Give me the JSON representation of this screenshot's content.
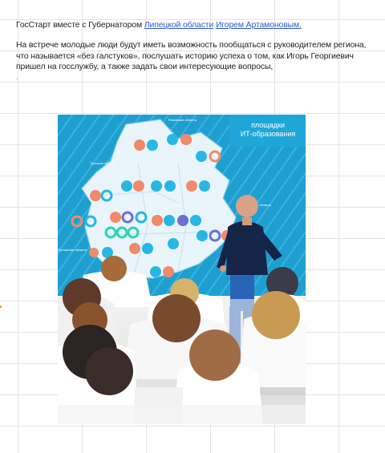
{
  "post": {
    "intro": "ГосСтарт  вместе с Губернатором",
    "link_region": "Липецкой области",
    "link_person": "Игорем Артамоновым.",
    "body": "На встрече молодые люди будут иметь возможность пообщаться с руководителем региона, что называется «без галстуков», послушать историю успеха о том, как Игорь Георгиевич пришел на госслужбу, а также задать свои интересующие вопросы,",
    "trailing": "."
  },
  "photo": {
    "banner_line1": "площадки",
    "banner_line2": "ИТ-образования",
    "map_title_top": "Рязанская область",
    "map_label_tula": "Тульская область",
    "map_label_tambov": "Тамбовская область",
    "map_label_orel": "Орловская область"
  }
}
